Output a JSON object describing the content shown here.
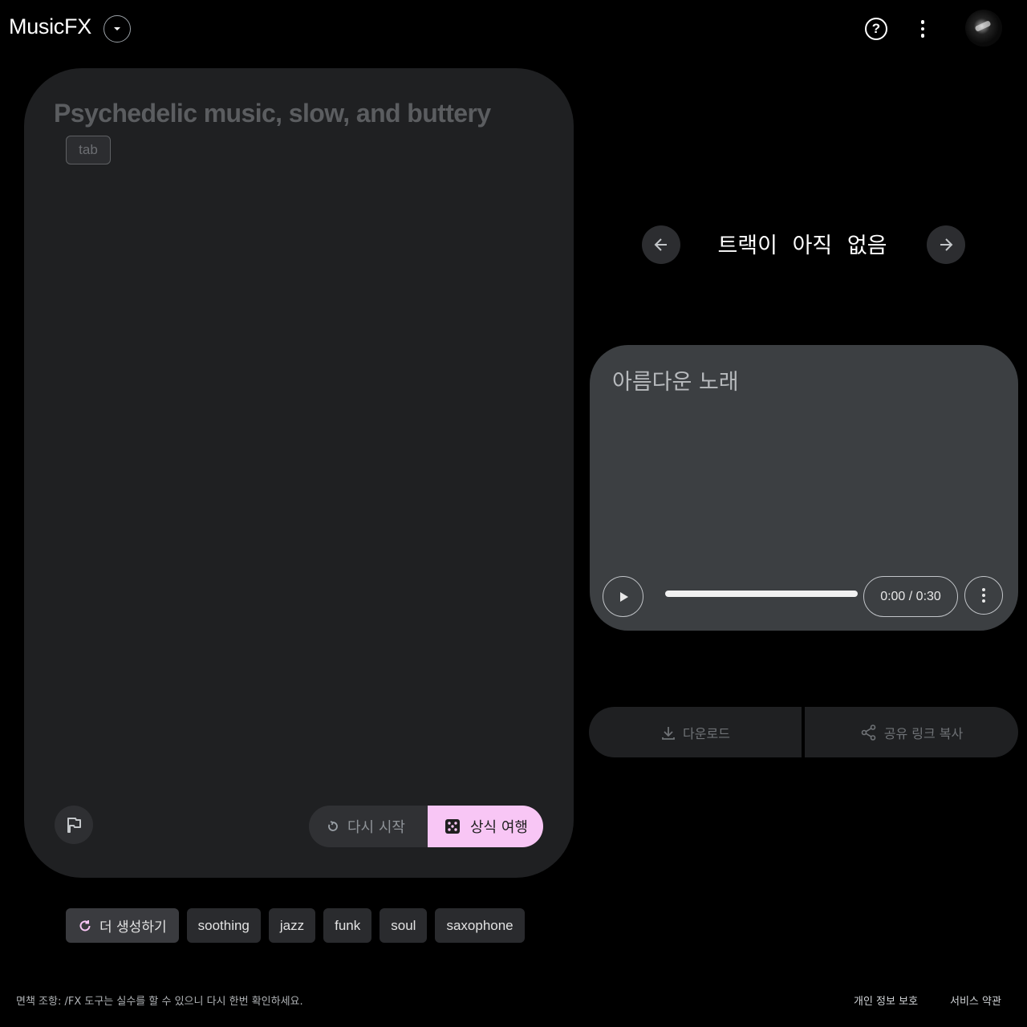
{
  "header": {
    "app_name": "MusicFX",
    "help_glyph": "?"
  },
  "prompt": {
    "text": "Psychedelic music, slow, and buttery",
    "tab_hint": "tab",
    "restart_label": "다시 시작",
    "trip_label": "상식 여행"
  },
  "tracks": {
    "status": "트랙이 아직 없음"
  },
  "track_card": {
    "title": "아름다운 노래",
    "time": "0:00 / 0:30",
    "progress": 0
  },
  "actions": {
    "download_label": "다운로드",
    "share_label": "공유 링크 복사"
  },
  "chips": {
    "regenerate_label": "더 생성하기",
    "items": [
      "soothing",
      "jazz",
      "funk",
      "soul",
      "saxophone"
    ]
  },
  "footer": {
    "disclaimer": "면책 조항: /FX 도구는 실수를 할 수 있으니 다시 한번 확인하세요.",
    "privacy": "개인 정보 보호",
    "terms": "서비스 약관"
  },
  "colors": {
    "background": "#000000",
    "card": "#1f2022",
    "track_card": "#3c3f42",
    "accent_pink": "#f8c6f5"
  },
  "icons": [
    "chevron-down-icon",
    "help-icon",
    "more-vert-icon",
    "flag-icon",
    "restart-icon",
    "dice-icon",
    "arrow-left-icon",
    "arrow-right-icon",
    "play-icon",
    "download-icon",
    "share-icon",
    "refresh-icon"
  ]
}
